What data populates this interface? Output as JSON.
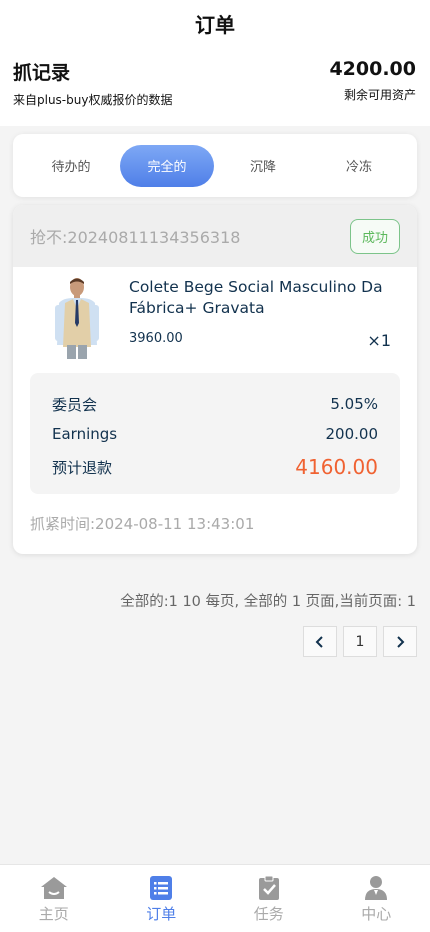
{
  "header": {
    "title": "订单"
  },
  "summary": {
    "title": "抓记录",
    "subtitle": "来自plus-buy权威报价的数据",
    "amount": "4200.00",
    "amount_label": "剩余可用资产"
  },
  "tabs": [
    {
      "label": "待办的",
      "active": false
    },
    {
      "label": "完全的",
      "active": true
    },
    {
      "label": "沉降",
      "active": false
    },
    {
      "label": "冷冻",
      "active": false
    }
  ],
  "order": {
    "number": "抢不:20240811134356318",
    "status": "成功",
    "product_name": "Colete Bege Social Masculino Da Fábrica+ Gravata",
    "price": "3960.00",
    "quantity": "×1",
    "details": [
      {
        "label": "委员会",
        "value": "5.05%"
      },
      {
        "label": "Earnings",
        "value": "200.00"
      },
      {
        "label": "预计退款",
        "value": "4160.00"
      }
    ],
    "time": "抓紧时间:2024-08-11 13:43:01"
  },
  "pagination": {
    "info": "全部的:1 10 每页, 全部的 1 页面,当前页面: 1",
    "prev_icon": "chevron-left-icon",
    "page": "1",
    "next_icon": "chevron-right-icon"
  },
  "bottom_nav": [
    {
      "label": "主页",
      "icon": "home-icon",
      "active": false
    },
    {
      "label": "订单",
      "icon": "list-icon",
      "active": true
    },
    {
      "label": "任务",
      "icon": "clipboard-icon",
      "active": false
    },
    {
      "label": "中心",
      "icon": "user-icon",
      "active": false
    }
  ],
  "colors": {
    "accent": "#4f7fe8",
    "success": "#5cb85c",
    "highlight": "#f06232"
  }
}
